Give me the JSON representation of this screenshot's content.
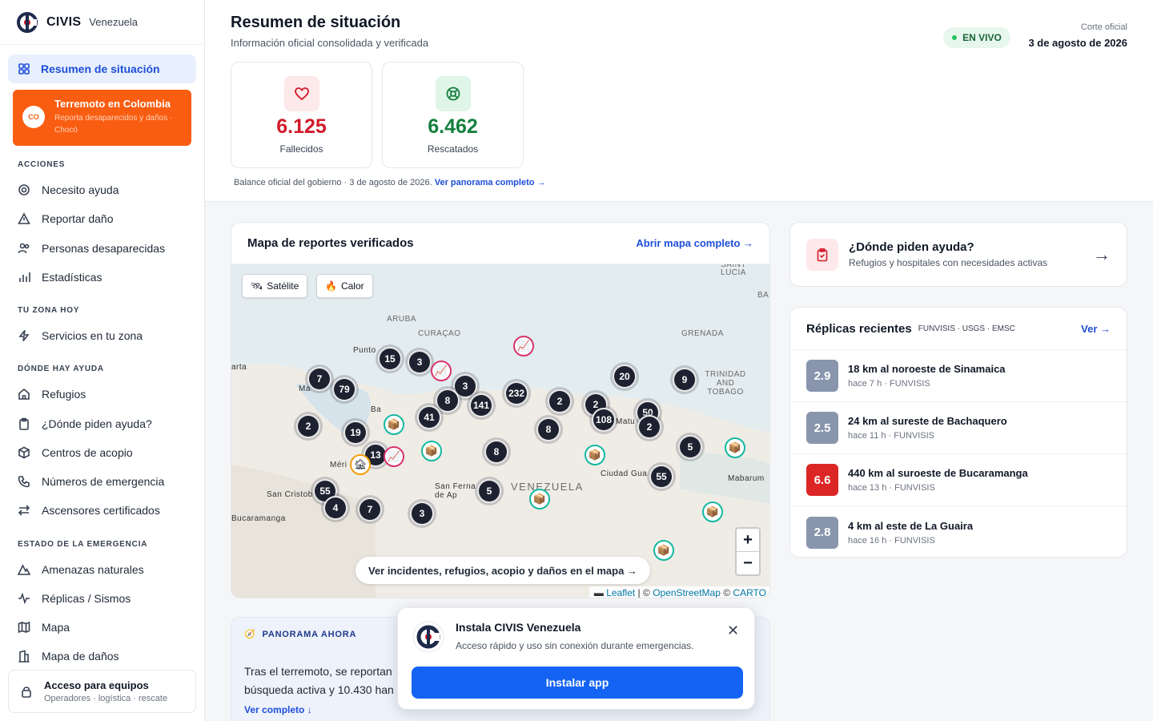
{
  "brand": {
    "name": "CIVIS",
    "country": "Venezuela"
  },
  "sidebar": {
    "active": "Resumen de situación",
    "alert": {
      "badge": "CO",
      "title": "Terremoto en Colombia",
      "sub": "Reporta desaparecidos y daños · Chocó"
    },
    "sections": [
      {
        "label": "ACCIONES",
        "items": [
          "Necesito ayuda",
          "Reportar daño",
          "Personas desaparecidas",
          "Estadísticas"
        ]
      },
      {
        "label": "TU ZONA HOY",
        "items": [
          "Servicios en tu zona"
        ]
      },
      {
        "label": "DÓNDE HAY AYUDA",
        "items": [
          "Refugios",
          "¿Dónde piden ayuda?",
          "Centros de acopio",
          "Números de emergencia",
          "Ascensores certificados"
        ]
      },
      {
        "label": "ESTADO DE LA EMERGENCIA",
        "items": [
          "Amenazas naturales",
          "Réplicas / Sismos",
          "Mapa",
          "Mapa de daños"
        ]
      }
    ],
    "team": {
      "title": "Acceso para equipos",
      "sub": "Operadores · logística · rescate"
    }
  },
  "header": {
    "title": "Resumen de situación",
    "subtitle": "Información oficial consolidada y verificada",
    "live": "EN VIVO",
    "cut_label": "Corte oficial",
    "cut_date": "3 de agosto de 2026"
  },
  "stats": [
    {
      "value": "6.125",
      "label": "Fallecidos",
      "color": "#d11a2a"
    },
    {
      "value": "6.462",
      "label": "Rescatados",
      "color": "#15803d"
    }
  ],
  "balance": {
    "text": "Balance oficial del gobierno · 3 de agosto de 2026.",
    "link": "Ver panorama completo →"
  },
  "map": {
    "title": "Mapa de reportes verificados",
    "link": "Abrir mapa completo →",
    "btn_sat": "Satélite",
    "btn_heat": "Calor",
    "cta": "Ver incidentes, refugios, acopio y daños en el mapa →",
    "attr_leaflet": "Leaflet",
    "attr_osm": "OpenStreetMap",
    "attr_carto": "CARTO",
    "zoom_in": "+",
    "zoom_out": "−",
    "labels": [
      "SAINT LUCIA",
      "ARUBA",
      "CURAÇAO",
      "GRENADA",
      "TRINIDAD AND TOBAGO",
      "Punto",
      "arta",
      "Ma",
      "Ba",
      "Méri",
      "San Cristob",
      "Bucaramanga",
      "San Ferna de Ap",
      "VENEZUELA",
      "Ciudad Gua",
      "Mabarum",
      "BA",
      "Matu"
    ],
    "clusters": [
      "15",
      "3",
      "7",
      "79",
      "3",
      "8",
      "232",
      "141",
      "41",
      "2",
      "20",
      "9",
      "2",
      "108",
      "50",
      "2",
      "8",
      "2",
      "19",
      "13",
      "8",
      "5",
      "55",
      "55",
      "4",
      "7",
      "3",
      "5"
    ]
  },
  "help": {
    "title": "¿Dónde piden ayuda?",
    "sub": "Refugios y hospitales con necesidades activas",
    "arrow": "→"
  },
  "replicas": {
    "title": "Réplicas recientes",
    "sources": "FUNVISIS · USGS · EMSC",
    "link": "Ver →",
    "items": [
      {
        "mag": "2.9",
        "place": "18 km al noroeste de Sinamaica",
        "meta": "hace 7 h · FUNVISIS"
      },
      {
        "mag": "2.5",
        "place": "24 km al sureste de Bachaquero",
        "meta": "hace 11 h · FUNVISIS"
      },
      {
        "mag": "6.6",
        "place": "440 km al suroeste de Bucaramanga",
        "meta": "hace 13 h · FUNVISIS"
      },
      {
        "mag": "2.8",
        "place": "4 km al este de La Guaira",
        "meta": "hace 16 h · FUNVISIS"
      }
    ]
  },
  "panorama": {
    "label": "PANORAMA AHORA",
    "text": "Tras el terremoto, se reportan búsqueda activa y 10.430 han",
    "more": "Ver completo ↓"
  },
  "install": {
    "title": "Instala CIVIS Venezuela",
    "sub": "Acceso rápido y uso sin conexión durante emergencias.",
    "close": "✕",
    "button": "Instalar app"
  }
}
